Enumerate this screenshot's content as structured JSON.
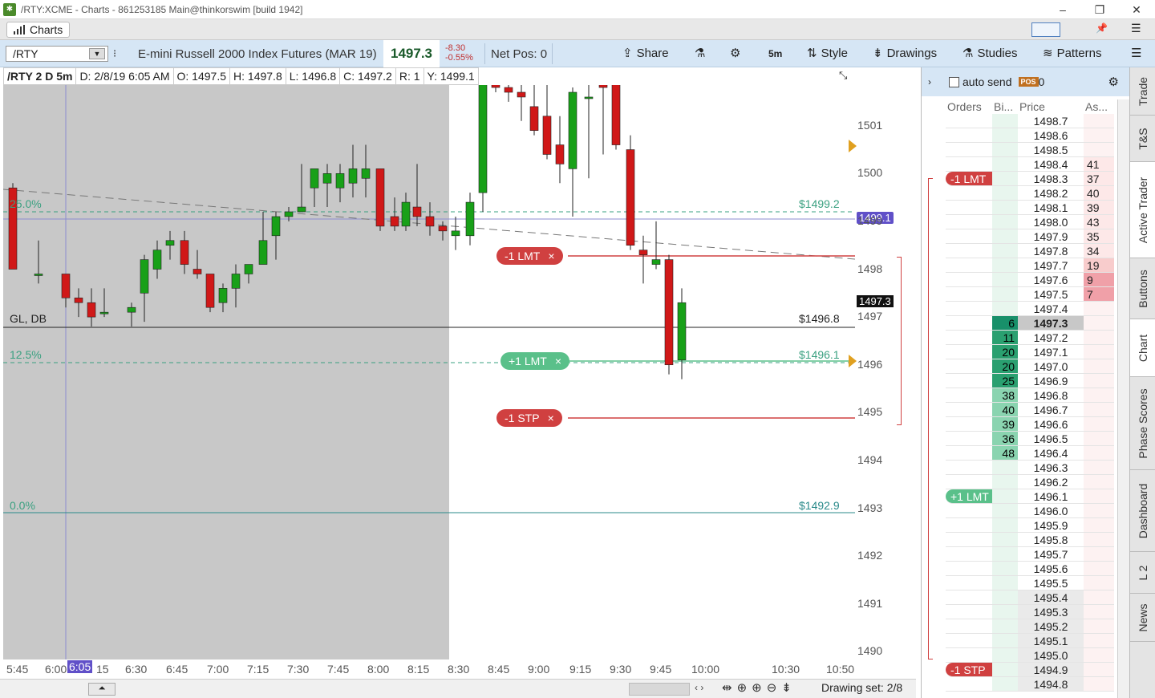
{
  "window": {
    "title": "/RTY:XCME - Charts - 861253185 Main@thinkorswim [build 1942]",
    "icon": "tos-logo-icon",
    "min": "–",
    "restore": "❐",
    "close": "✕"
  },
  "tab": {
    "label": "Charts"
  },
  "toolbar": {
    "symbol": "/RTY",
    "description": "E-mini Russell 2000 Index Futures (MAR 19)",
    "price": "1497.3",
    "change": "-8.30",
    "change_pct": "-0.55%",
    "net_pos": "Net Pos: 0",
    "share": "Share",
    "timeframe": "5m",
    "style": "Style",
    "drawings": "Drawings",
    "studies": "Studies",
    "patterns": "Patterns"
  },
  "info": {
    "symbol": "/RTY 2 D 5m",
    "date": "D: 2/8/19 6:05 AM",
    "open": "O: 1497.5",
    "high": "H: 1497.8",
    "low": "L: 1496.8",
    "close": "C: 1497.2",
    "range": "R: 1",
    "y": "Y: 1499.1"
  },
  "levels": {
    "fib25": "25.0%",
    "fib125": "12.5%",
    "fib0": "0.0%",
    "gl": "GL, DB",
    "p1": "$1499.2",
    "p2": "$1496.8",
    "p3": "$1496.1",
    "p4": "$1492.9"
  },
  "orders": {
    "lmt_sell": "-1 LMT",
    "lmt_buy": "+1 LMT",
    "stp": "-1 STP",
    "close": "×"
  },
  "yaxis": {
    "labels": [
      "1501",
      "1500",
      "1499",
      "1498",
      "1497",
      "1496",
      "1495",
      "1494",
      "1493",
      "1492",
      "1491",
      "1490"
    ],
    "crosshair": "1499.1",
    "last": "1497.3"
  },
  "xaxis": {
    "labels": [
      "5:45",
      "6:00",
      "6:05",
      "15",
      "6:30",
      "6:45",
      "7:00",
      "7:15",
      "7:30",
      "7:45",
      "8:00",
      "8:15",
      "8:30",
      "8:45",
      "9:00",
      "9:15",
      "9:30",
      "9:45",
      "10:00",
      "10:30",
      "10:50"
    ]
  },
  "bottom": {
    "drawing_set": "Drawing set: 2/8"
  },
  "panel": {
    "auto_send": "auto send",
    "pos_badge": "POS",
    "pos_val": "0",
    "headers": [
      "Orders",
      "Bi...",
      "Price",
      "As..."
    ]
  },
  "ladder": [
    {
      "o": "",
      "b": "",
      "p": "1498.7",
      "a": ""
    },
    {
      "o": "",
      "b": "",
      "p": "1498.6",
      "a": ""
    },
    {
      "o": "",
      "b": "",
      "p": "1498.5",
      "a": ""
    },
    {
      "o": "",
      "b": "",
      "p": "1498.4",
      "a": "41"
    },
    {
      "o": "-1 LMT",
      "b": "",
      "p": "1498.3",
      "a": "37"
    },
    {
      "o": "",
      "b": "",
      "p": "1498.2",
      "a": "40"
    },
    {
      "o": "",
      "b": "",
      "p": "1498.1",
      "a": "39"
    },
    {
      "o": "",
      "b": "",
      "p": "1498.0",
      "a": "43"
    },
    {
      "o": "",
      "b": "",
      "p": "1497.9",
      "a": "35"
    },
    {
      "o": "",
      "b": "",
      "p": "1497.8",
      "a": "34"
    },
    {
      "o": "",
      "b": "",
      "p": "1497.7",
      "a": "19"
    },
    {
      "o": "",
      "b": "",
      "p": "1497.6",
      "a": "9"
    },
    {
      "o": "",
      "b": "",
      "p": "1497.5",
      "a": "7"
    },
    {
      "o": "",
      "b": "",
      "p": "1497.4",
      "a": ""
    },
    {
      "o": "",
      "b": "6",
      "p": "1497.3",
      "a": ""
    },
    {
      "o": "",
      "b": "11",
      "p": "1497.2",
      "a": ""
    },
    {
      "o": "",
      "b": "20",
      "p": "1497.1",
      "a": ""
    },
    {
      "o": "",
      "b": "20",
      "p": "1497.0",
      "a": ""
    },
    {
      "o": "",
      "b": "25",
      "p": "1496.9",
      "a": ""
    },
    {
      "o": "",
      "b": "38",
      "p": "1496.8",
      "a": ""
    },
    {
      "o": "",
      "b": "40",
      "p": "1496.7",
      "a": ""
    },
    {
      "o": "",
      "b": "39",
      "p": "1496.6",
      "a": ""
    },
    {
      "o": "",
      "b": "36",
      "p": "1496.5",
      "a": ""
    },
    {
      "o": "",
      "b": "48",
      "p": "1496.4",
      "a": ""
    },
    {
      "o": "",
      "b": "",
      "p": "1496.3",
      "a": ""
    },
    {
      "o": "",
      "b": "",
      "p": "1496.2",
      "a": ""
    },
    {
      "o": "+1 LMT",
      "b": "",
      "p": "1496.1",
      "a": ""
    },
    {
      "o": "",
      "b": "",
      "p": "1496.0",
      "a": ""
    },
    {
      "o": "",
      "b": "",
      "p": "1495.9",
      "a": ""
    },
    {
      "o": "",
      "b": "",
      "p": "1495.8",
      "a": ""
    },
    {
      "o": "",
      "b": "",
      "p": "1495.7",
      "a": ""
    },
    {
      "o": "",
      "b": "",
      "p": "1495.6",
      "a": ""
    },
    {
      "o": "",
      "b": "",
      "p": "1495.5",
      "a": ""
    },
    {
      "o": "",
      "b": "",
      "p": "1495.4",
      "a": ""
    },
    {
      "o": "",
      "b": "",
      "p": "1495.3",
      "a": ""
    },
    {
      "o": "",
      "b": "",
      "p": "1495.2",
      "a": ""
    },
    {
      "o": "",
      "b": "",
      "p": "1495.1",
      "a": ""
    },
    {
      "o": "",
      "b": "",
      "p": "1495.0",
      "a": ""
    },
    {
      "o": "-1 STP",
      "b": "",
      "p": "1494.9",
      "a": ""
    },
    {
      "o": "",
      "b": "",
      "p": "1494.8",
      "a": ""
    }
  ],
  "sidetabs": [
    "Trade",
    "T&S",
    "Active Trader",
    "Buttons",
    "Chart",
    "Phase Scores",
    "Dashboard",
    "L 2",
    "News"
  ],
  "candles": [
    {
      "o": 1499.7,
      "h": 1499.8,
      "l": 1498.0,
      "c": 1498.0
    },
    {
      "o": 1497.9,
      "h": 1498.6,
      "l": 1497.7,
      "c": 1497.9
    },
    {
      "o": 1497.9,
      "h": 1497.9,
      "l": 1497.2,
      "c": 1497.4
    },
    {
      "o": 1497.4,
      "h": 1497.6,
      "l": 1497.0,
      "c": 1497.3
    },
    {
      "o": 1497.3,
      "h": 1497.6,
      "l": 1496.8,
      "c": 1497.0
    },
    {
      "o": 1497.1,
      "h": 1497.6,
      "l": 1497.0,
      "c": 1497.1
    },
    {
      "o": 1497.1,
      "h": 1497.3,
      "l": 1496.8,
      "c": 1497.2
    },
    {
      "o": 1497.5,
      "h": 1498.3,
      "l": 1496.9,
      "c": 1498.2
    },
    {
      "o": 1498.0,
      "h": 1498.6,
      "l": 1497.8,
      "c": 1498.4
    },
    {
      "o": 1498.5,
      "h": 1498.8,
      "l": 1498.2,
      "c": 1498.6
    },
    {
      "o": 1498.6,
      "h": 1498.8,
      "l": 1497.9,
      "c": 1498.1
    },
    {
      "o": 1498.0,
      "h": 1498.4,
      "l": 1497.8,
      "c": 1497.9
    },
    {
      "o": 1497.9,
      "h": 1497.9,
      "l": 1497.1,
      "c": 1497.2
    },
    {
      "o": 1497.3,
      "h": 1497.7,
      "l": 1497.1,
      "c": 1497.6
    },
    {
      "o": 1497.6,
      "h": 1498.1,
      "l": 1497.2,
      "c": 1497.9
    },
    {
      "o": 1497.9,
      "h": 1497.9,
      "l": 1497.7,
      "c": 1498.1
    },
    {
      "o": 1498.1,
      "h": 1499.2,
      "l": 1498.1,
      "c": 1498.6
    },
    {
      "o": 1498.7,
      "h": 1499.2,
      "l": 1498.2,
      "c": 1499.1
    },
    {
      "o": 1499.1,
      "h": 1499.3,
      "l": 1499.0,
      "c": 1499.2
    },
    {
      "o": 1499.2,
      "h": 1500.2,
      "l": 1499.2,
      "c": 1499.3
    },
    {
      "o": 1499.7,
      "h": 1500.1,
      "l": 1499.3,
      "c": 1500.1
    },
    {
      "o": 1499.8,
      "h": 1500.2,
      "l": 1499.3,
      "c": 1500.0
    },
    {
      "o": 1499.7,
      "h": 1500.2,
      "l": 1499.4,
      "c": 1500.0
    },
    {
      "o": 1499.8,
      "h": 1500.6,
      "l": 1499.5,
      "c": 1500.1
    },
    {
      "o": 1499.9,
      "h": 1500.6,
      "l": 1499.5,
      "c": 1500.1
    },
    {
      "o": 1500.1,
      "h": 1500.1,
      "l": 1498.8,
      "c": 1498.9
    },
    {
      "o": 1499.1,
      "h": 1499.5,
      "l": 1498.8,
      "c": 1498.9
    },
    {
      "o": 1498.9,
      "h": 1499.6,
      "l": 1498.8,
      "c": 1499.4
    },
    {
      "o": 1499.3,
      "h": 1500.2,
      "l": 1498.9,
      "c": 1499.1
    },
    {
      "o": 1499.1,
      "h": 1499.4,
      "l": 1498.7,
      "c": 1498.9
    },
    {
      "o": 1498.9,
      "h": 1499.0,
      "l": 1498.6,
      "c": 1498.8
    },
    {
      "o": 1498.7,
      "h": 1499.1,
      "l": 1498.4,
      "c": 1498.8
    },
    {
      "o": 1498.7,
      "h": 1499.6,
      "l": 1498.5,
      "c": 1499.4
    },
    {
      "o": 1499.6,
      "h": 1502.0,
      "l": 1499.2,
      "c": 1501.9
    },
    {
      "o": 1501.9,
      "h": 1502.0,
      "l": 1501.7,
      "c": 1501.8
    },
    {
      "o": 1501.8,
      "h": 1502.2,
      "l": 1501.5,
      "c": 1501.7
    },
    {
      "o": 1501.7,
      "h": 1502.0,
      "l": 1501.1,
      "c": 1501.6
    },
    {
      "o": 1501.4,
      "h": 1502.0,
      "l": 1500.8,
      "c": 1500.9
    },
    {
      "o": 1501.2,
      "h": 1502.3,
      "l": 1500.3,
      "c": 1500.4
    },
    {
      "o": 1500.6,
      "h": 1501.2,
      "l": 1499.8,
      "c": 1500.2
    },
    {
      "o": 1500.1,
      "h": 1501.8,
      "l": 1499.1,
      "c": 1501.7
    },
    {
      "o": 1501.6,
      "h": 1501.9,
      "l": 1499.9,
      "c": 1501.6
    },
    {
      "o": 1501.9,
      "h": 1502.0,
      "l": 1500.4,
      "c": 1501.8
    },
    {
      "o": 1501.9,
      "h": 1502.0,
      "l": 1500.5,
      "c": 1500.6
    },
    {
      "o": 1500.5,
      "h": 1500.8,
      "l": 1498.4,
      "c": 1498.5
    },
    {
      "o": 1498.4,
      "h": 1498.7,
      "l": 1497.7,
      "c": 1498.3
    },
    {
      "o": 1498.1,
      "h": 1499.0,
      "l": 1498.0,
      "c": 1498.2
    },
    {
      "o": 1498.2,
      "h": 1498.3,
      "l": 1495.8,
      "c": 1496.0
    },
    {
      "o": 1496.1,
      "h": 1497.6,
      "l": 1495.7,
      "c": 1497.3
    }
  ]
}
